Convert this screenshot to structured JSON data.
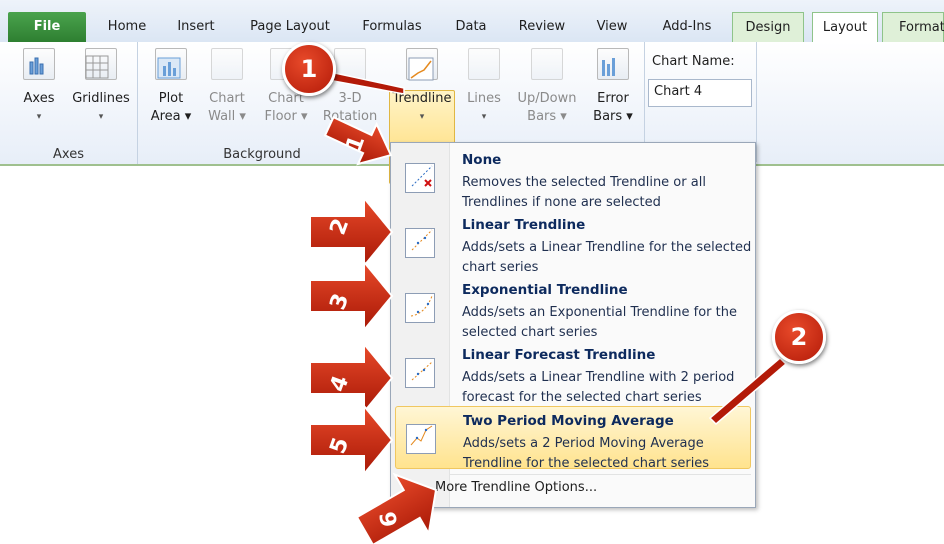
{
  "tabs": [
    {
      "label": "File"
    },
    {
      "label": "Home"
    },
    {
      "label": "Insert"
    },
    {
      "label": "Page Layout"
    },
    {
      "label": "Formulas"
    },
    {
      "label": "Data"
    },
    {
      "label": "Review"
    },
    {
      "label": "View"
    },
    {
      "label": "Add-Ins"
    },
    {
      "label": "Design"
    },
    {
      "label": "Layout"
    },
    {
      "label": "Format"
    }
  ],
  "ribbon": {
    "axes_group": {
      "label": "Axes",
      "buttons": [
        {
          "line1": "Axes",
          "line2": "▾"
        },
        {
          "line1": "Gridlines",
          "line2": "▾"
        }
      ]
    },
    "background_group": {
      "label": "Background",
      "buttons": [
        {
          "line1": "Plot",
          "line2": "Area ▾"
        },
        {
          "line1": "Chart",
          "line2": "Wall ▾"
        },
        {
          "line1": "Chart",
          "line2": "Floor ▾"
        },
        {
          "line1": "3-D",
          "line2": "Rotation"
        }
      ]
    },
    "analysis_group": {
      "buttons": [
        {
          "line1": "Trendline",
          "line2": "▾"
        },
        {
          "line1": "Lines",
          "line2": "▾"
        },
        {
          "line1": "Up/Down",
          "line2": "Bars ▾"
        },
        {
          "line1": "Error",
          "line2": "Bars ▾"
        }
      ]
    },
    "chart_name_label": "Chart Name:",
    "chart_name_value": "Chart 4"
  },
  "menu": {
    "items": [
      {
        "title": "None",
        "desc": "Removes the selected Trendline or all Trendlines if none are selected",
        "icon": "trendline-none-icon"
      },
      {
        "title": "Linear Trendline",
        "desc": "Adds/sets a Linear Trendline for the selected chart series",
        "icon": "linear-trendline-icon"
      },
      {
        "title": "Exponential Trendline",
        "desc": "Adds/sets an Exponential Trendline for the selected chart series",
        "icon": "exponential-trendline-icon"
      },
      {
        "title": "Linear Forecast Trendline",
        "desc": "Adds/sets a Linear Trendline with 2 period forecast for the selected chart series",
        "icon": "linear-forecast-trendline-icon"
      },
      {
        "title": "Two Period Moving Average",
        "desc": "Adds/sets a 2 Period Moving Average Trendline for the selected chart series",
        "icon": "moving-average-trendline-icon"
      }
    ],
    "more_options": "More Trendline Options..."
  },
  "callouts": {
    "circle1": "1",
    "circle2": "2",
    "arrows": [
      "1",
      "2",
      "3",
      "4",
      "5",
      "6"
    ]
  },
  "colors": {
    "callout_red": "#c8260c",
    "highlight_yellow": "#ffe38e",
    "tab_green": "#2e7f31"
  }
}
